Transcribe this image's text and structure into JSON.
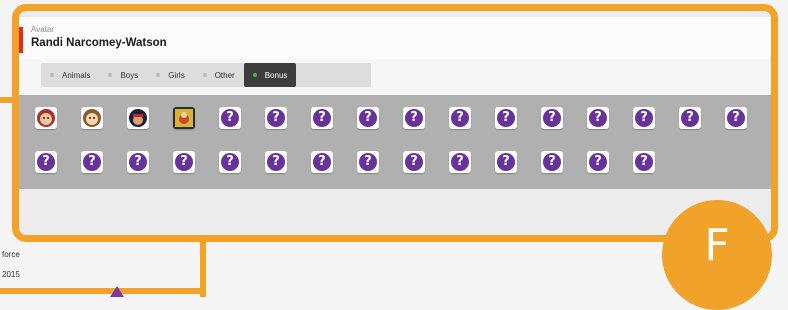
{
  "header": {
    "small_label": "Avatar",
    "name": "Randi Narcomey-Watson"
  },
  "tabs": [
    {
      "label": "Animals",
      "active": false
    },
    {
      "label": "Boys",
      "active": false
    },
    {
      "label": "Girls",
      "active": false
    },
    {
      "label": "Other",
      "active": false
    },
    {
      "label": "Bonus",
      "active": true
    }
  ],
  "avatars": {
    "unlocked": [
      "avatar-1",
      "avatar-2",
      "avatar-3",
      "avatar-4"
    ],
    "locked_symbol": "?",
    "locked_count": 26
  },
  "background": {
    "text_force": "force",
    "text_year": "2015"
  },
  "badge": {
    "letter": "F"
  },
  "colors": {
    "accent_orange": "#f0a22a",
    "locked_purple": "#67329a",
    "active_tab": "#3d3d3d",
    "active_dot": "#36c43c",
    "red_accent": "#e42b1e"
  }
}
